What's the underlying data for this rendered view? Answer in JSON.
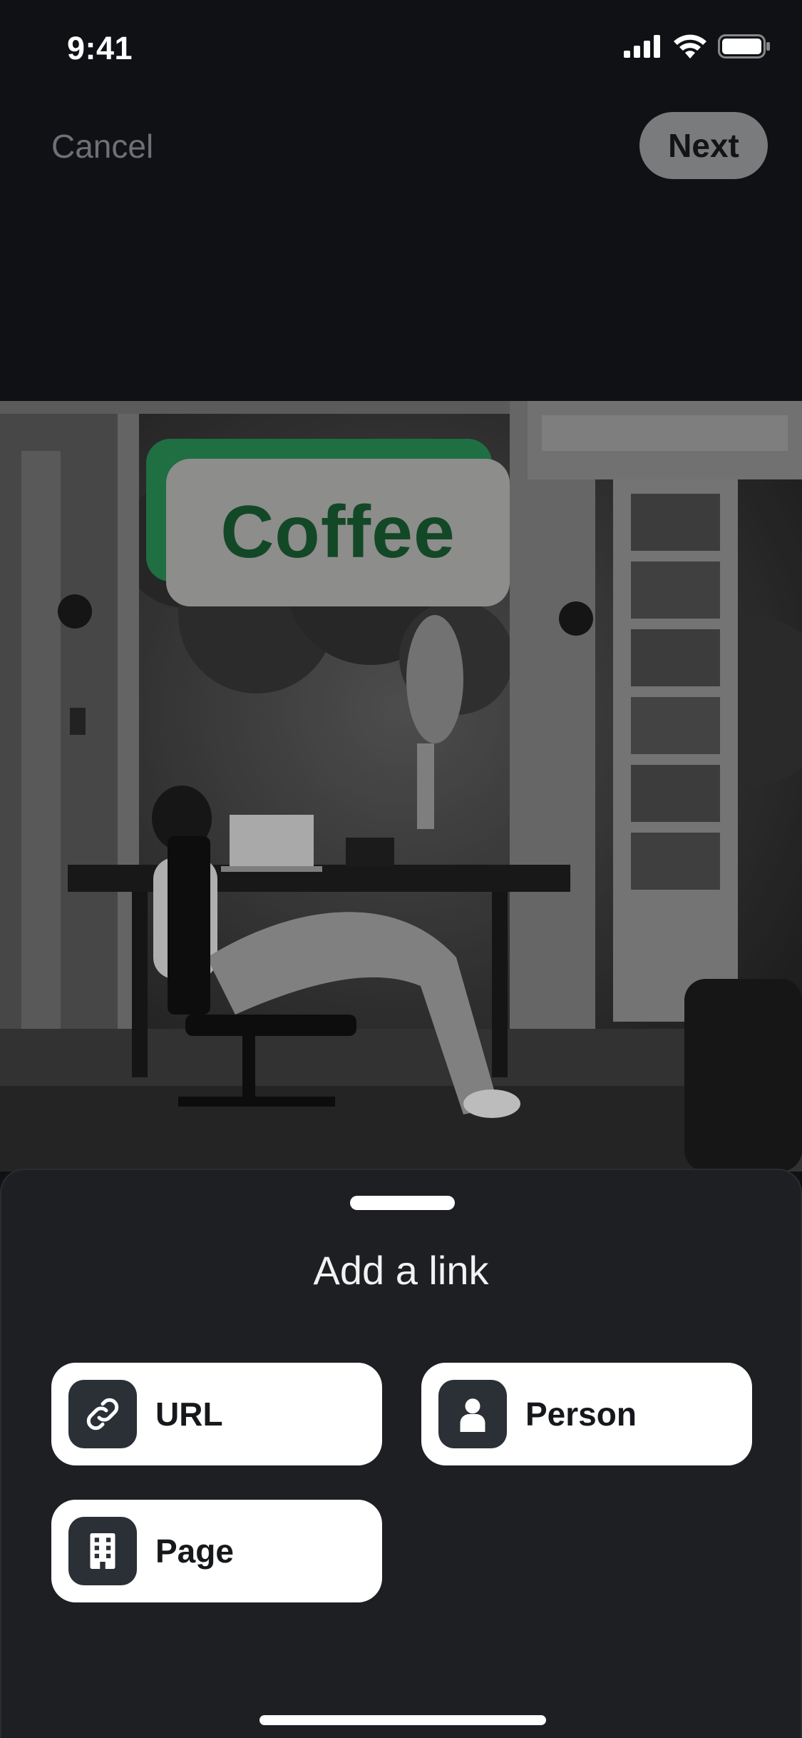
{
  "status_bar": {
    "time": "9:41",
    "icons": [
      "cellular-signal-icon",
      "wifi-icon",
      "battery-icon"
    ]
  },
  "nav": {
    "cancel_label": "Cancel",
    "next_label": "Next"
  },
  "photo": {
    "description_icon": "photo-image"
  },
  "sticker": {
    "text": "Coffee",
    "colors": {
      "back": "#1f6f43",
      "front": "#8d8d8b",
      "text": "#134827"
    }
  },
  "sheet": {
    "title": "Add a link",
    "options": [
      {
        "label": "URL",
        "icon": "link-icon"
      },
      {
        "label": "Person",
        "icon": "person-icon"
      },
      {
        "label": "Page",
        "icon": "building-icon"
      }
    ]
  },
  "colors": {
    "background": "#0f1114",
    "sheet": "#1d1f23",
    "option_bg": "#ffffff",
    "icon_tile": "#2b2f36"
  }
}
